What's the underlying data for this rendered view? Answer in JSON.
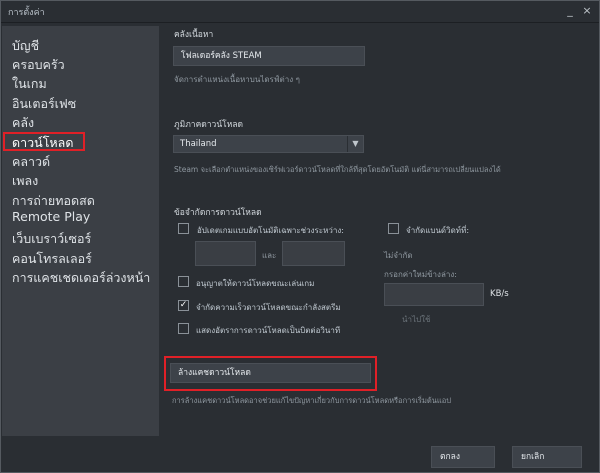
{
  "window": {
    "title": "การตั้งค่า",
    "minimize_glyph": "_",
    "close_glyph": "×"
  },
  "sidebar": {
    "items": [
      {
        "label": "บัญชี"
      },
      {
        "label": "ครอบครัว"
      },
      {
        "label": "ในเกม"
      },
      {
        "label": "อินเตอร์เฟซ"
      },
      {
        "label": "คลัง"
      },
      {
        "label": "ดาวน์โหลด",
        "active": true
      },
      {
        "label": "คลาวด์"
      },
      {
        "label": "เพลง"
      },
      {
        "label": "การถ่ายทอดสด"
      },
      {
        "label": "Remote Play"
      },
      {
        "label": "เว็บเบราว์เซอร์"
      },
      {
        "label": "คอนโทรลเลอร์"
      },
      {
        "label": "การแคชเชดเดอร์ล่วงหน้า"
      }
    ]
  },
  "library": {
    "title": "คลังเนื้อหา",
    "button": "โฟลเดอร์คลัง STEAM",
    "description": "จัดการตำแหน่งเนื้อหาบนไดรฟ์ต่าง ๆ"
  },
  "region": {
    "title": "ภูมิภาคดาวน์โหลด",
    "selected": "Thailand",
    "description": "Steam จะเลือกตำแหน่งของเซิร์ฟเวอร์ดาวน์โหลดที่ใกล้ที่สุดโดยอัตโนมัติ แต่นี่สามารถเปลี่ยนแปลงได้"
  },
  "restrictions": {
    "title": "ข้อจำกัดการดาวน์โหลด",
    "auto_update_label": "อัปเดตเกมแบบอัตโนมัติเฉพาะช่วงระหว่าง:",
    "and_label": "และ",
    "limit_bandwidth_label": "จำกัดแบนด์วิดท์ที่:",
    "no_limit": "ไม่จำกัด",
    "enter_value_label": "กรอกค่าใหม่ข้างล่าง:",
    "unit": "KB/s",
    "apply_label": "นำไปใช้",
    "allow_while_playing": "อนุญาตให้ดาวน์โหลดขณะเล่นเกม",
    "throttle_streaming": "จำกัดความเร็วดาวน์โหลดขณะกำลังสตรีม",
    "show_bits": "แสดงอัตราการดาวน์โหลดเป็นบิตต่อวินาที"
  },
  "checkboxes": {
    "auto_update": false,
    "limit_bandwidth": false,
    "allow_while_playing": false,
    "throttle_streaming": true,
    "show_bits": false
  },
  "cache": {
    "button": "ล้างแคชดาวน์โหลด",
    "description": "การล้างแคชดาวน์โหลดอาจช่วยแก้ไขปัญหาเกี่ยวกับการดาวน์โหลดหรือการเริ่มต้นแอป"
  },
  "footer": {
    "ok": "ตกลง",
    "cancel": "ยกเลิก"
  },
  "colors": {
    "highlight": "#e02027",
    "background": "#2a2e33",
    "sidebar": "#3b3f45"
  }
}
